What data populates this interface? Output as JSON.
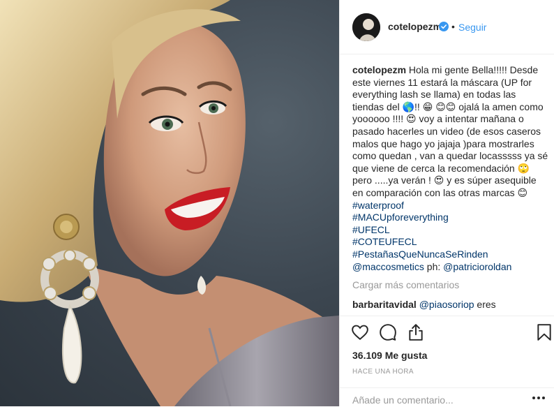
{
  "header": {
    "username": "cotelopezm",
    "separator": "•",
    "follow_label": "Seguir"
  },
  "caption": {
    "username": "cotelopezm",
    "text": "Hola mi gente Bella!!!!! Desde este viernes 11 estará la máscara (UP for everything lash se llama) en todas las tiendas del 🌎!! 😁 😊😊 ojalá la amen como yoooooo !!!! 😍 voy a intentar mañana o pasado hacerles un video (de esos caseros malos que hago yo jajaja )para mostrarles como quedan , van a quedar locasssss ya sé que viene de cerca la recomendación 🙄 pero .....ya verán ! 😍 y es súper asequible en comparación con las otras marcas 😊",
    "hashtags": [
      "#waterproof",
      "#MACUpforeverything",
      "#UFECL",
      "#COTEUFECL",
      "#PestañasQueNuncaSeRinden"
    ],
    "mention_main": "@maccosmetics",
    "photo_credit_prefix": "ph:",
    "mention_photo": "@patricioroldan"
  },
  "load_more_label": "Cargar más comentarios",
  "comment": {
    "username": "barbaritavidal",
    "mention": "@piaosoriop",
    "text": "eres"
  },
  "likes_text": "36.109 Me gusta",
  "timestamp": "HACE UNA HORA",
  "add_comment": {
    "placeholder": "Añade un comentario..."
  },
  "icons": {
    "like": "heart-icon",
    "comment": "comment-bubble-icon",
    "share": "share-icon",
    "save": "bookmark-icon",
    "more": "more-options-icon",
    "verified": "verified-badge-icon"
  },
  "colors": {
    "link": "#3897f0",
    "hashtag": "#003569",
    "muted": "#999999",
    "text": "#262626"
  }
}
